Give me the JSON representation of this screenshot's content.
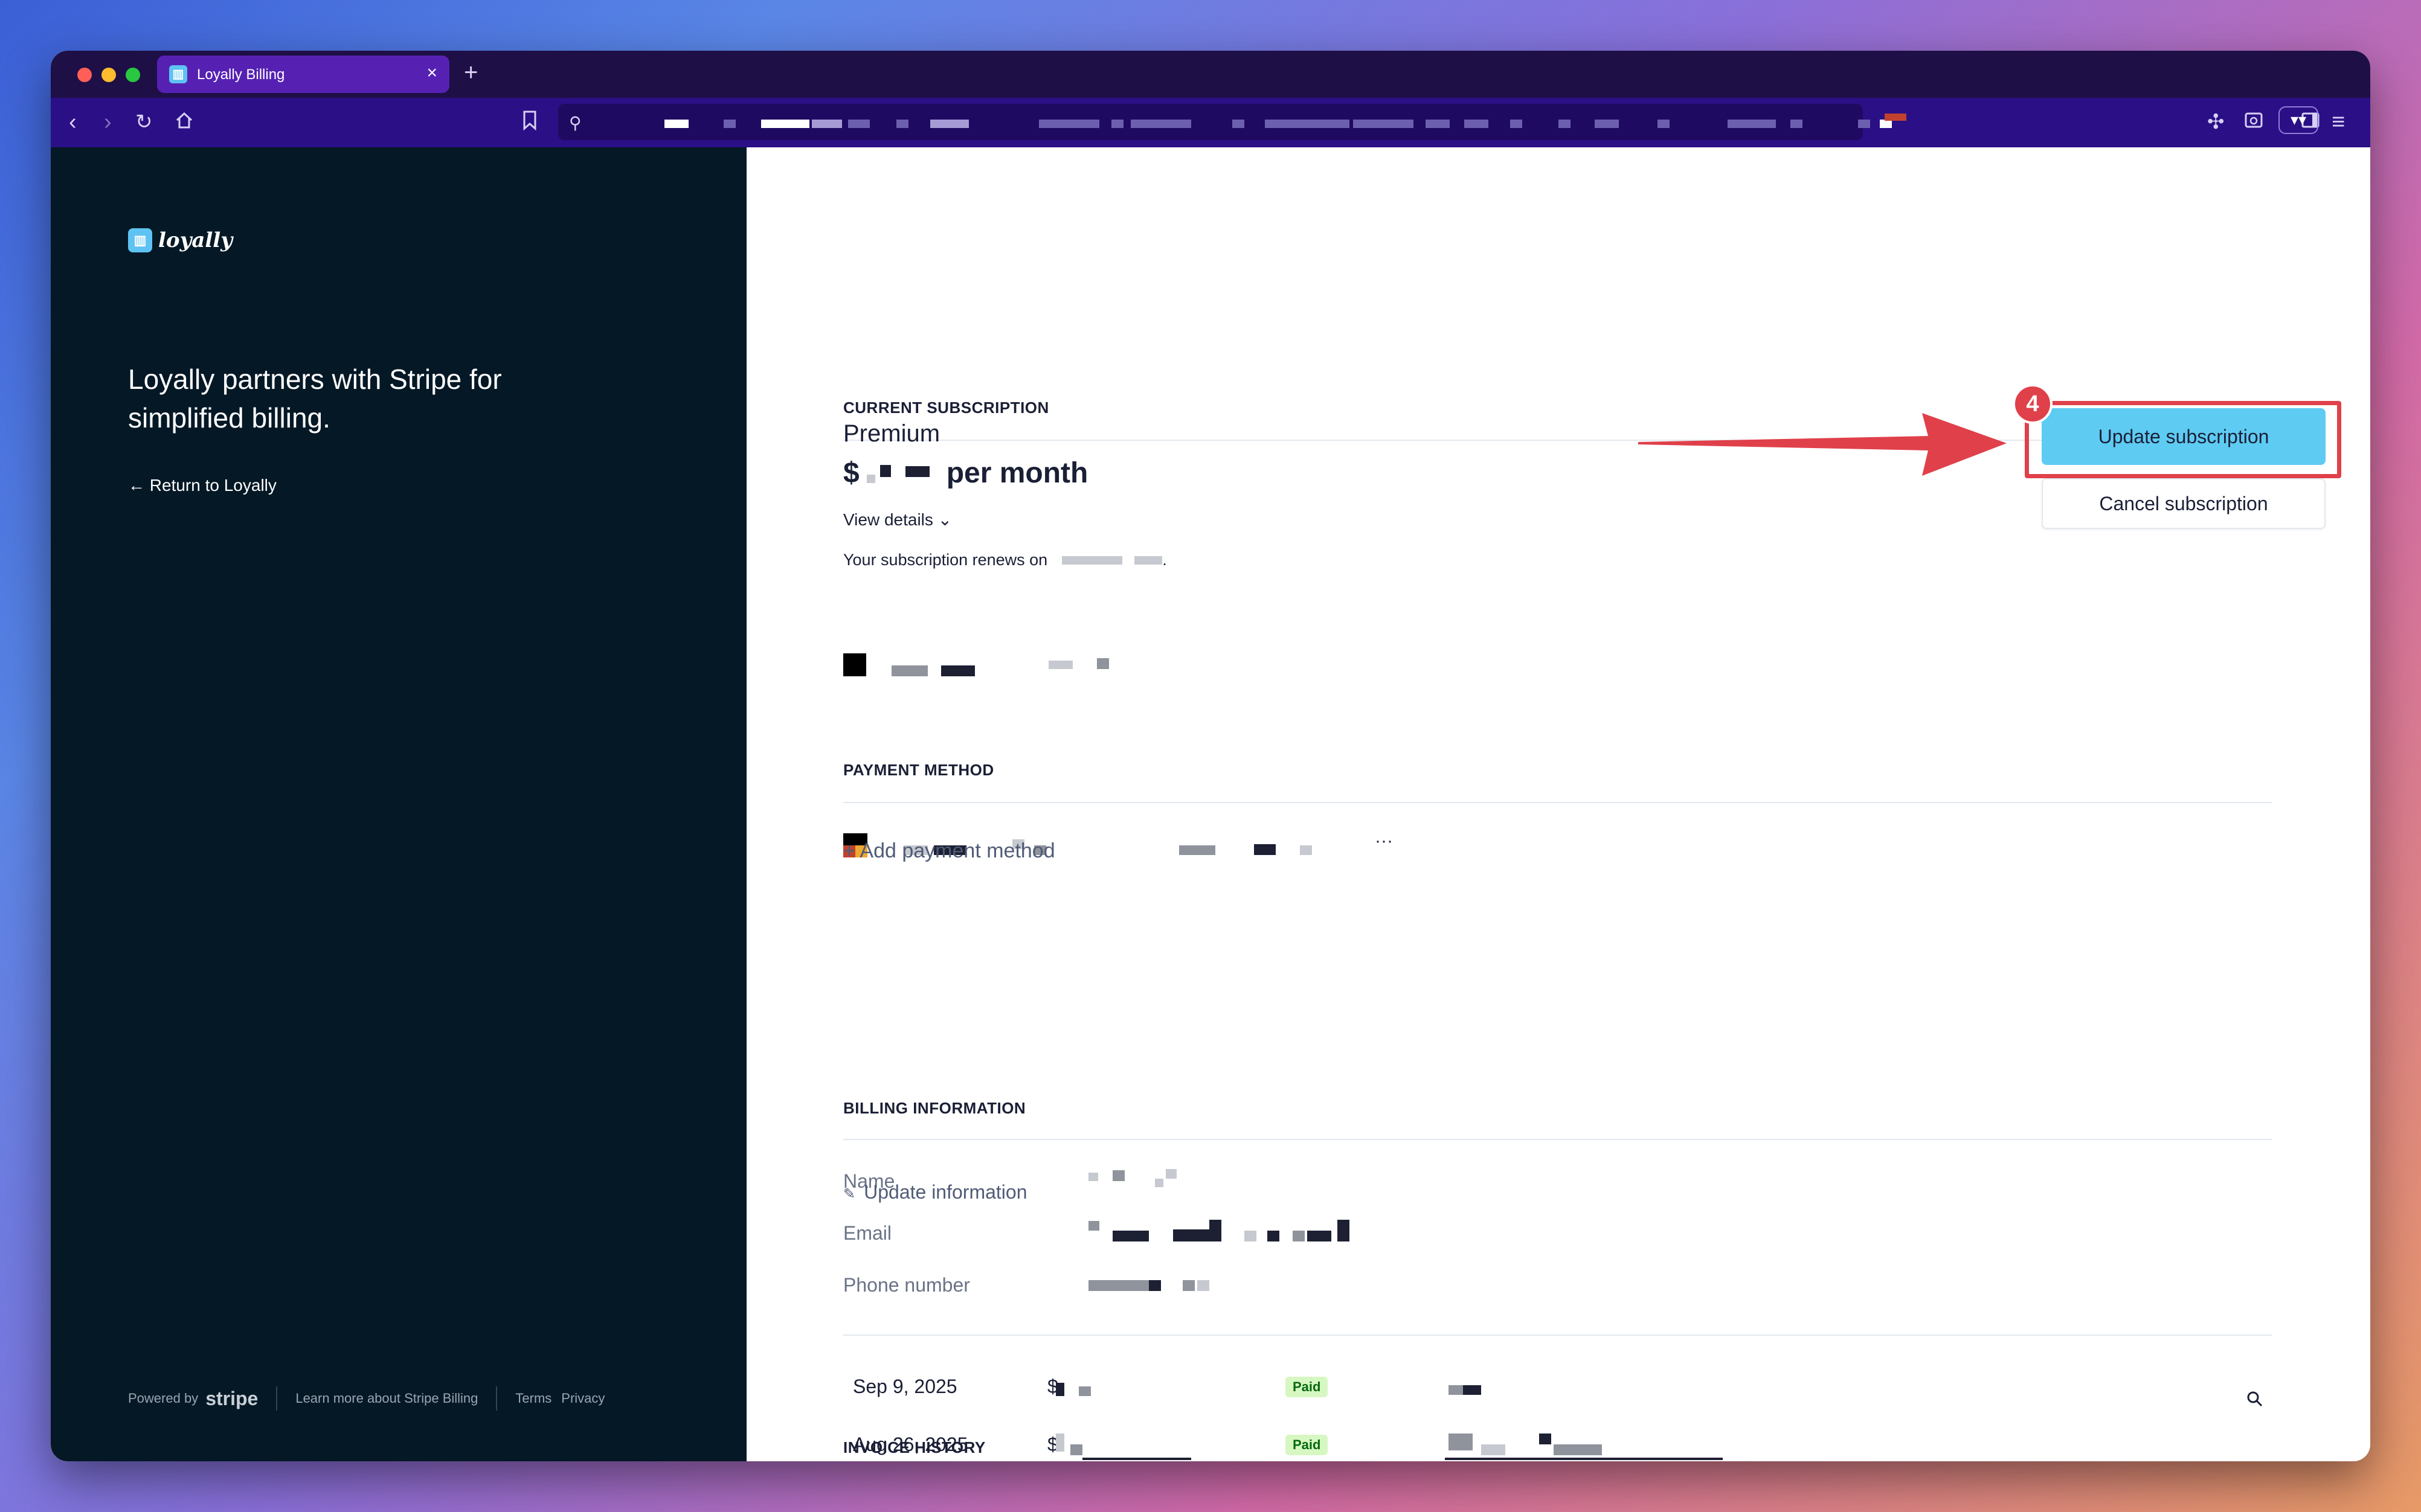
{
  "browser": {
    "tab_title": "Loyally Billing",
    "tab_close": "×",
    "new_tab": "+"
  },
  "sidebar": {
    "logo_text": "loyally",
    "headline": "Loyally partners with Stripe for simplified billing.",
    "return_link": "← Return to Loyally",
    "footer": {
      "powered_by": "Powered by",
      "stripe": "stripe",
      "learn_more": "Learn more about Stripe Billing",
      "terms": "Terms",
      "privacy": "Privacy"
    }
  },
  "subscription": {
    "section_title": "CURRENT SUBSCRIPTION",
    "plan_name": "Premium",
    "currency_symbol": "$",
    "period": "per month",
    "view_details": "View details ⌄",
    "renews_text": "Your subscription renews on",
    "update_button": "Update subscription",
    "cancel_button": "Cancel subscription"
  },
  "annotation": {
    "step_number": "4",
    "color": "#e0404a"
  },
  "payment": {
    "section_title": "PAYMENT METHOD",
    "more": "···",
    "add_payment": "+  Add payment method"
  },
  "billing": {
    "section_title": "BILLING INFORMATION",
    "name_label": "Name",
    "email_label": "Email",
    "phone_label": "Phone number",
    "update_info": "Update information"
  },
  "invoices": {
    "section_title": "INVOICE HISTORY",
    "rows": [
      {
        "date": "Sep 9, 2025",
        "amount": "$",
        "status": "Paid"
      },
      {
        "date": "Aug 26, 2025",
        "amount": "$",
        "status": "Paid"
      }
    ]
  },
  "colors": {
    "sidebar_bg": "#051826",
    "accent_button": "#5ecbf3",
    "browser_chrome": "#2a0f86"
  }
}
